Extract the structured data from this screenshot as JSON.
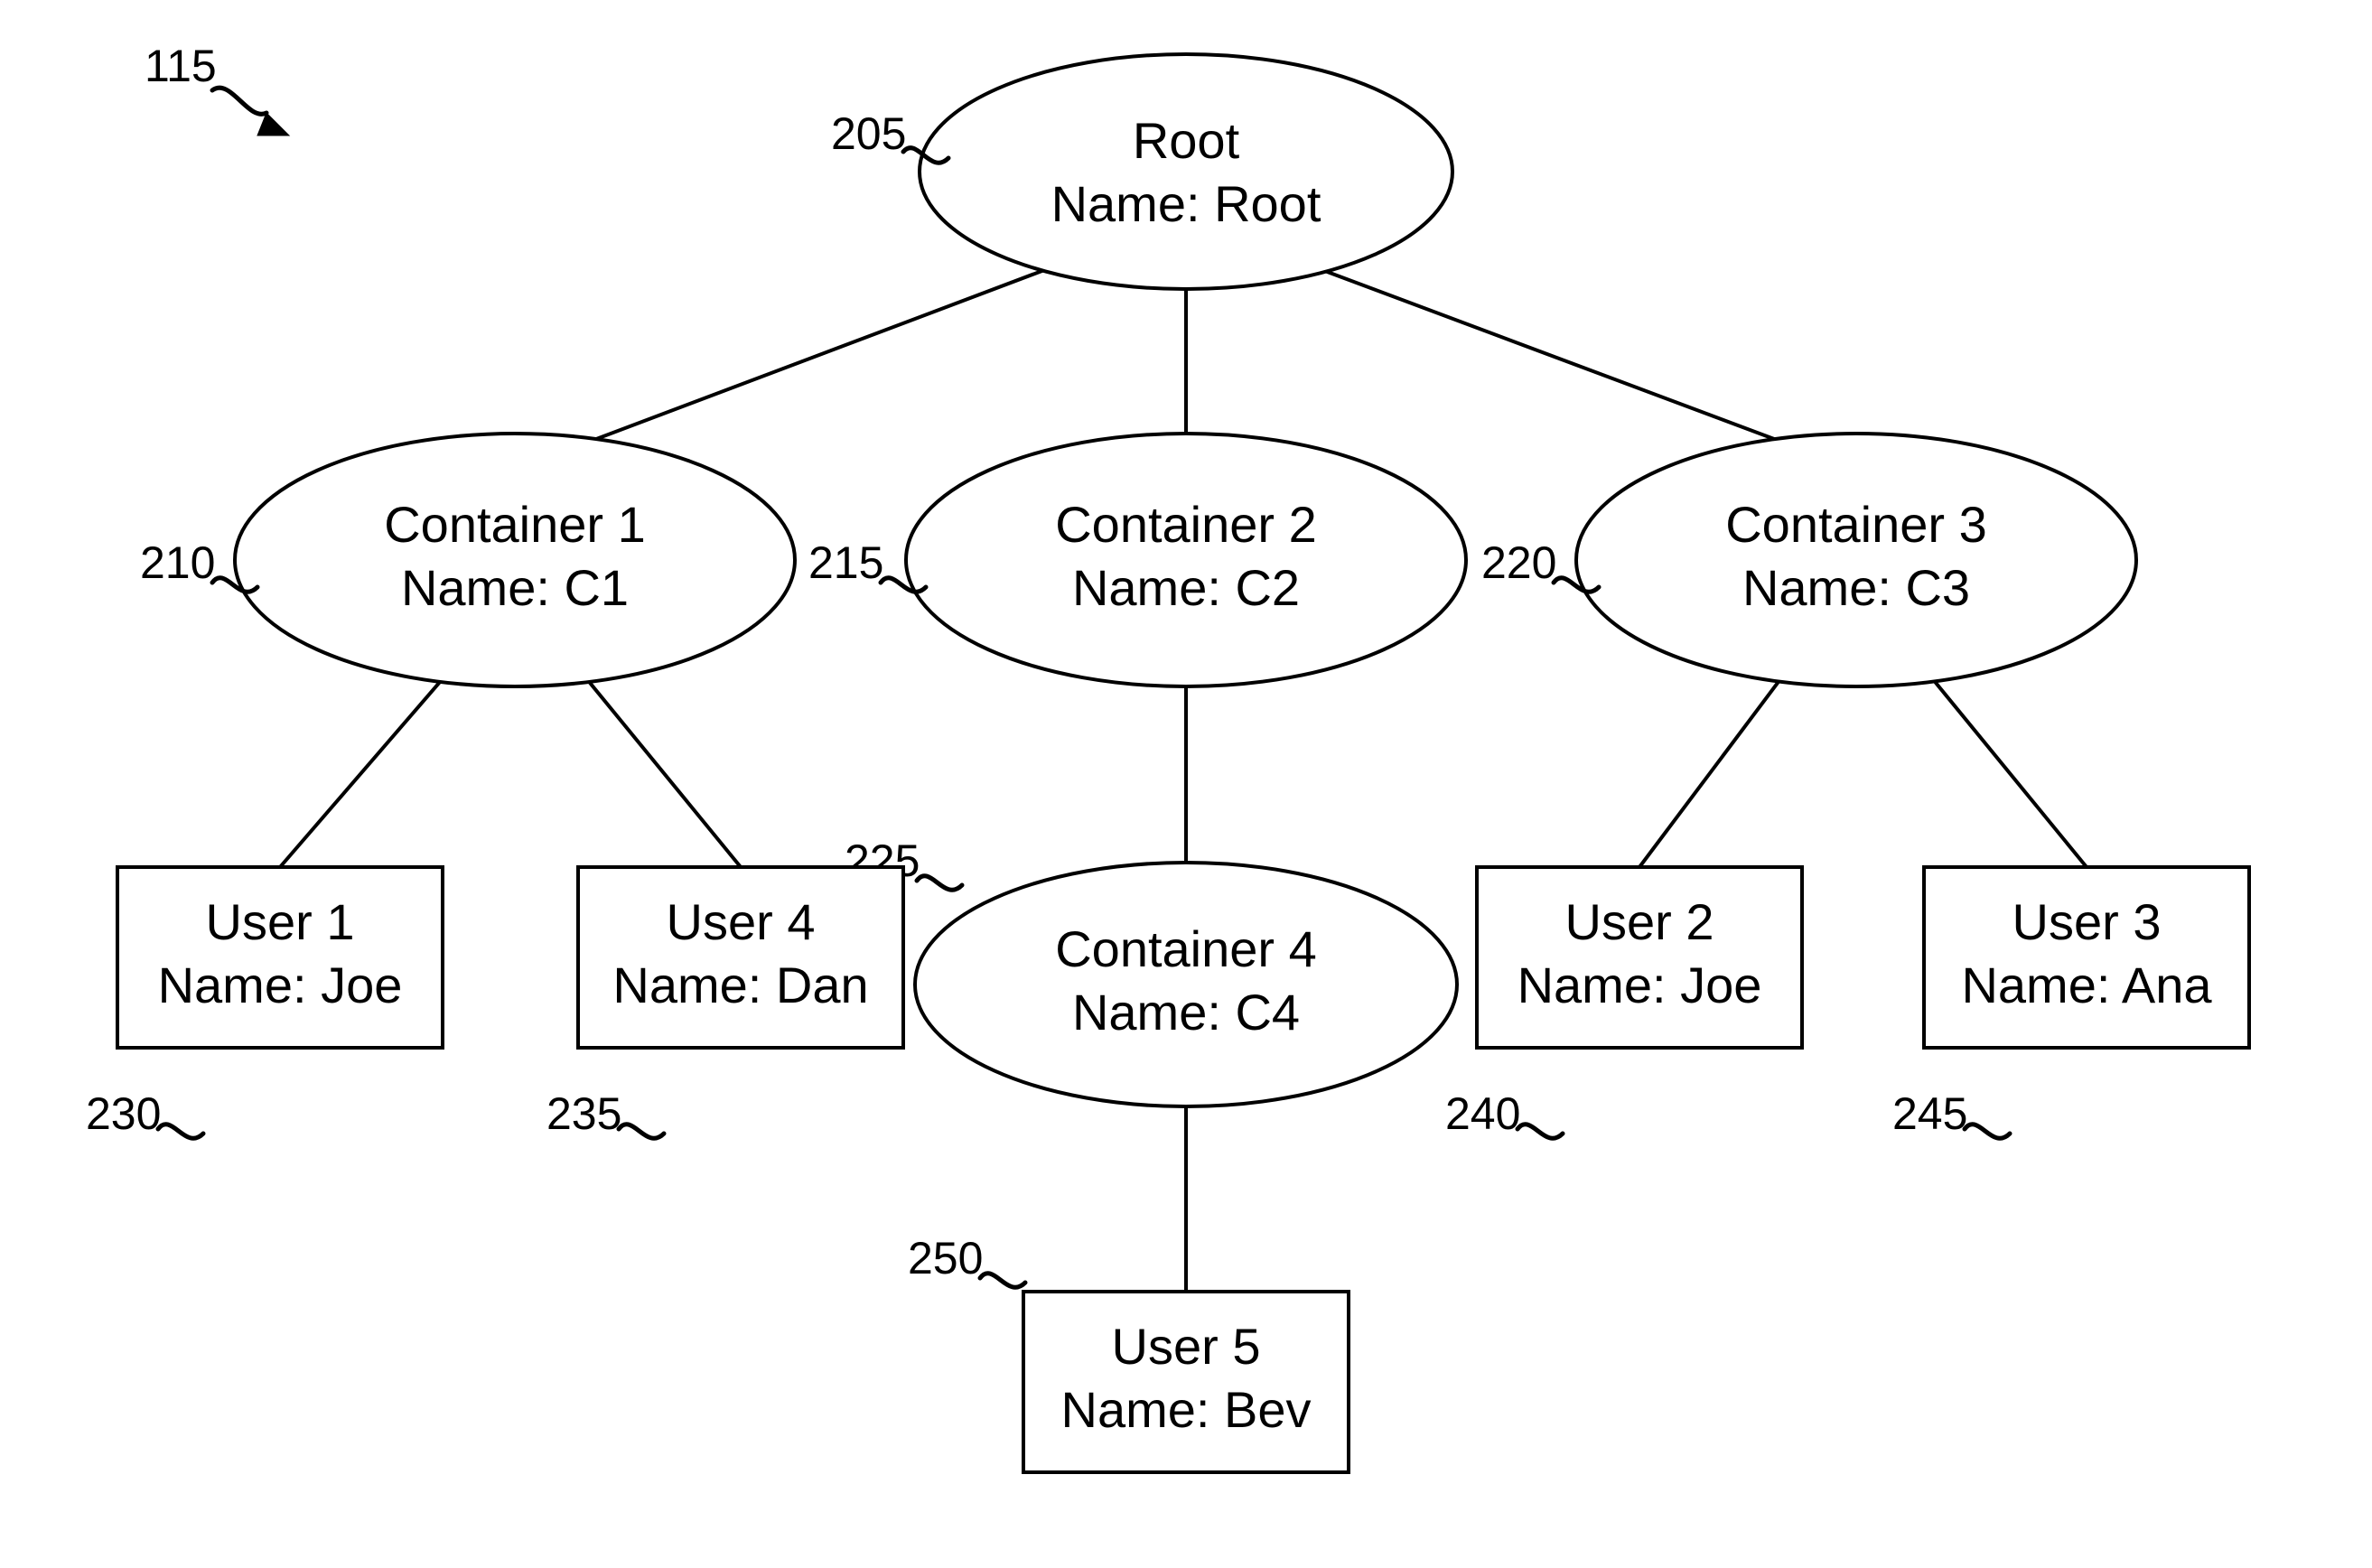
{
  "figure_ref": "115",
  "nodes": {
    "root": {
      "ref": "205",
      "line1": "Root",
      "line2": "Name: Root"
    },
    "c1": {
      "ref": "210",
      "line1": "Container 1",
      "line2": "Name: C1"
    },
    "c2": {
      "ref": "215",
      "line1": "Container 2",
      "line2": "Name: C2"
    },
    "c3": {
      "ref": "220",
      "line1": "Container 3",
      "line2": "Name: C3"
    },
    "c4": {
      "ref": "225",
      "line1": "Container 4",
      "line2": "Name: C4"
    },
    "u1": {
      "ref": "230",
      "line1": "User 1",
      "line2": "Name: Joe"
    },
    "u4": {
      "ref": "235",
      "line1": "User 4",
      "line2": "Name: Dan"
    },
    "u2": {
      "ref": "240",
      "line1": "User 2",
      "line2": "Name: Joe"
    },
    "u3": {
      "ref": "245",
      "line1": "User 3",
      "line2": "Name: Ana"
    },
    "u5": {
      "ref": "250",
      "line1": "User 5",
      "line2": "Name: Bev"
    }
  }
}
